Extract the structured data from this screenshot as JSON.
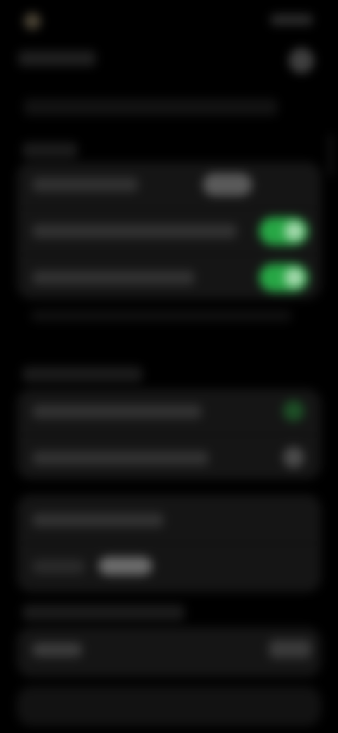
{
  "status_bar": {
    "time": "",
    "icons": [
      "signal-icon",
      "wifi-icon",
      "battery-icon"
    ]
  },
  "header": {
    "title": "",
    "avatar": "avatar"
  },
  "notice": "",
  "sections": [
    {
      "title": "",
      "rows": [
        {
          "label": "",
          "control": "pill",
          "value": ""
        },
        {
          "label": "",
          "control": "toggle",
          "value": "on"
        },
        {
          "label": "",
          "control": "toggle",
          "value": "on"
        }
      ],
      "footnote": ""
    },
    {
      "title": "",
      "rows": [
        {
          "label": "",
          "control": "status-dot",
          "value": "green"
        },
        {
          "label": "",
          "control": "status-dot",
          "value": "grey"
        }
      ]
    },
    {
      "title": "",
      "rows": [
        {
          "label": "",
          "control": "none"
        },
        {
          "label": "",
          "control": "chip",
          "value": ""
        }
      ]
    },
    {
      "title": "",
      "rows": [
        {
          "label": "",
          "control": "button",
          "value": ""
        }
      ]
    }
  ],
  "colors": {
    "background": "#000000",
    "card": "#151515",
    "accent": "#27a745",
    "text": "#6b6b6b"
  }
}
